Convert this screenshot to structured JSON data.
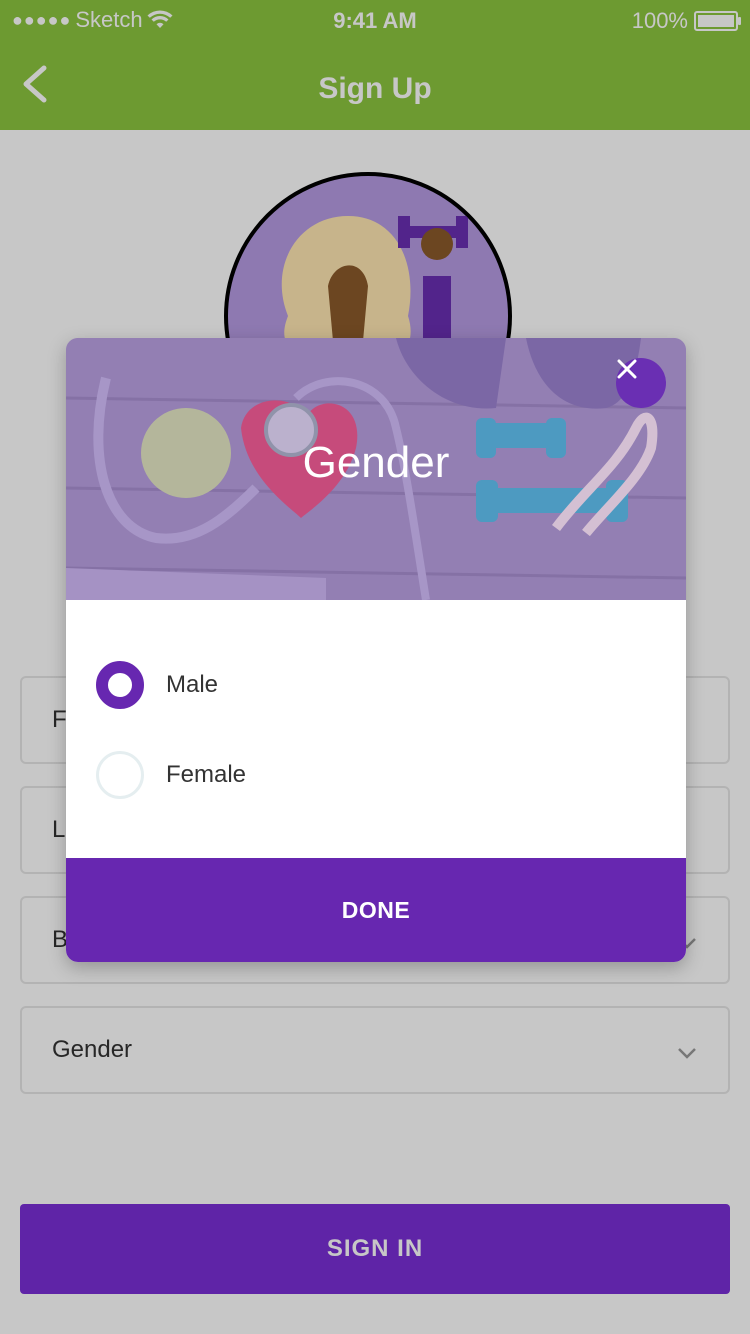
{
  "status_bar": {
    "carrier": "Sketch",
    "time": "9:41 AM",
    "battery": "100%"
  },
  "nav": {
    "title": "Sign Up"
  },
  "form": {
    "fields": [
      {
        "label": "F",
        "has_chevron": false
      },
      {
        "label": "L",
        "has_chevron": false
      },
      {
        "label": "B",
        "has_chevron": true
      },
      {
        "label": "Gender",
        "has_chevron": true
      }
    ],
    "signin_label": "SIGN IN"
  },
  "modal": {
    "title": "Gender",
    "options": [
      {
        "label": "Male",
        "selected": true
      },
      {
        "label": "Female",
        "selected": false
      }
    ],
    "done_label": "DONE"
  },
  "colors": {
    "brand_green": "#8cc63f",
    "brand_purple": "#6727b0",
    "signin_purple": "#7a2fd7",
    "avatar_bg": "#b69ce3"
  },
  "icons": [
    "back-chevron-icon",
    "wifi-icon",
    "battery-icon",
    "close-icon",
    "chevron-down-icon"
  ]
}
